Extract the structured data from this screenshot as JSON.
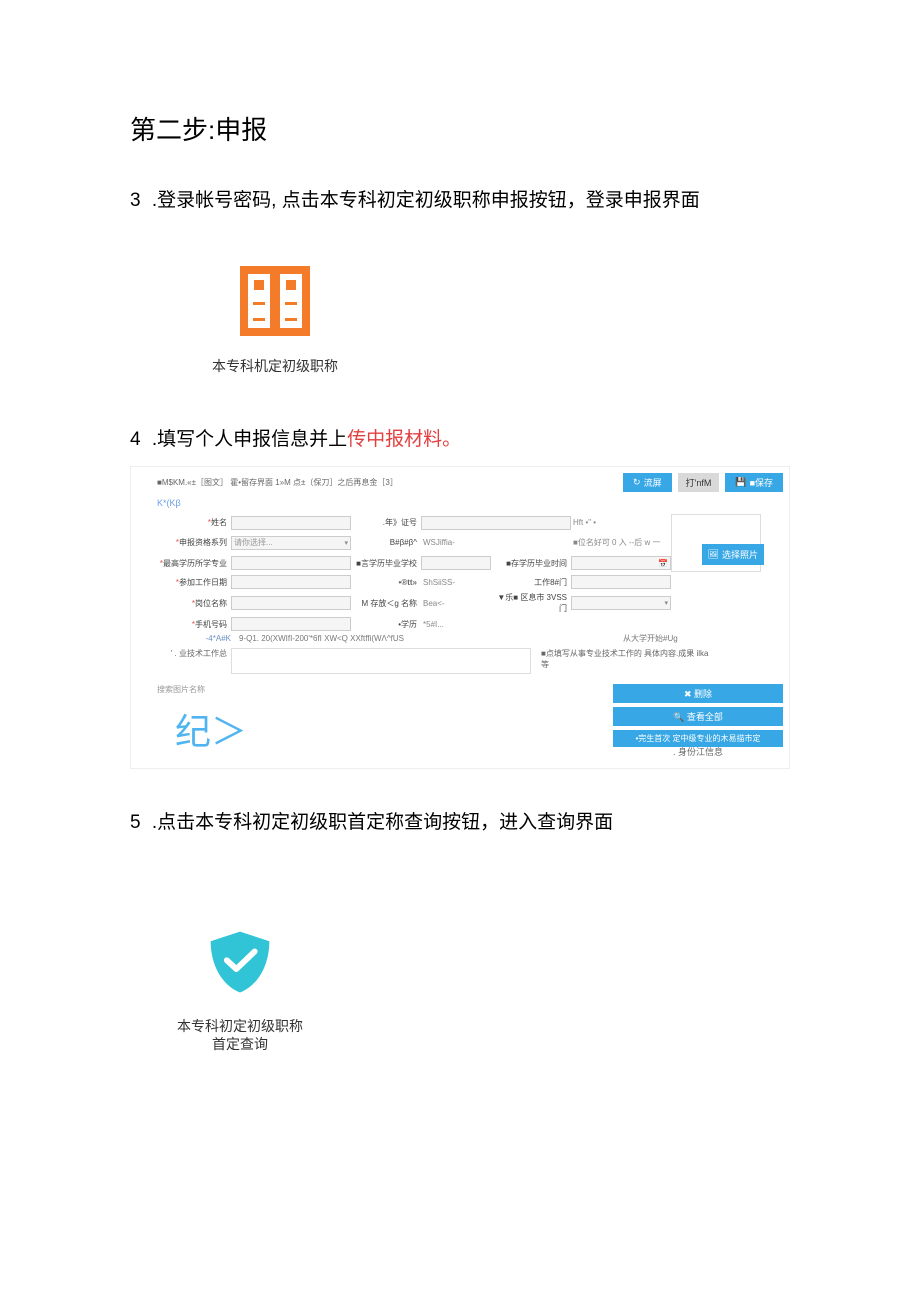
{
  "step_title": "第二步:申报",
  "para3": {
    "n": "3",
    "text": ".登录帐号密码, 点击本专科初定初级职称申报按钮，登录申报界面"
  },
  "icon1_label": "本专科机定初级职称",
  "para4": {
    "n": "4",
    "text_plain": ".填写个人申报信息并上",
    "text_red": "传中报材料。"
  },
  "form": {
    "top_hint": "■M$KM.«±［图文］ 霍•留存界面 1»M 点±（保刀］之后再息金［3］",
    "btn_refresh": "流屏",
    "btn_print": "打'nfM",
    "btn_save": "■保存",
    "app_no": "K*(Kβ",
    "rows": {
      "r1": {
        "l1": "姓名",
        "v1": "",
        "l2": ".年》证号",
        "v2": "",
        "l3": "Hft •\" •"
      },
      "r2": {
        "l1": "申报资格系列",
        "v1": "请你选择...",
        "l2": "B#β#β^",
        "v2": "WSJiffia-",
        "l3": "■位名好可 0 入 --后 w 一"
      },
      "r3": {
        "l1": "最高学历所学专业",
        "v1": "",
        "l2": "■言学历毕业学校",
        "v2": "",
        "l3": "■存学历毕业时间"
      },
      "r4": {
        "l1": "参加工作日期",
        "v1": "",
        "l2": "•®tt»",
        "v2": "ShSiiSS-",
        "l3": "工作8#门"
      },
      "r5": {
        "l1": "岗位名称",
        "v1": "",
        "l2": "M 存放＜g 名称",
        "v2": "Bea<-",
        "l3": "▼乐■ 区息市 3VSS门"
      },
      "r6": {
        "l1": "手机号码",
        "v1": "",
        "l2": "•学历",
        "v2": "*5#I..."
      }
    },
    "addr": {
      "l": "-4*A#K",
      "mid": "9-Q1. 20(XWIfI-200'*6fI XW<Q XXftffi(WΛ^fUS",
      "right": "从大学开始#Ug"
    },
    "summary": {
      "l": "' . 业技术工作总",
      "note": "■点填写从事专业技术工作的 具体内容.成果 ilka 等"
    },
    "search_label": "搜索图片名称",
    "ji_text": "纪＞",
    "btn_del": "✖ 删除",
    "btn_view": "🔍 查看全部",
    "btn_submit": "•完生首次 定中级专业的木易描市定",
    "idinfo": ". 身份江信息",
    "pick_photo": "选择照片"
  },
  "para5": {
    "n": "5",
    "text": ".点击本专科初定初级职首定称查询按钮，进入查询界面"
  },
  "shield_label_l1": "本专科初定初级职称",
  "shield_label_l2": "首定查询"
}
